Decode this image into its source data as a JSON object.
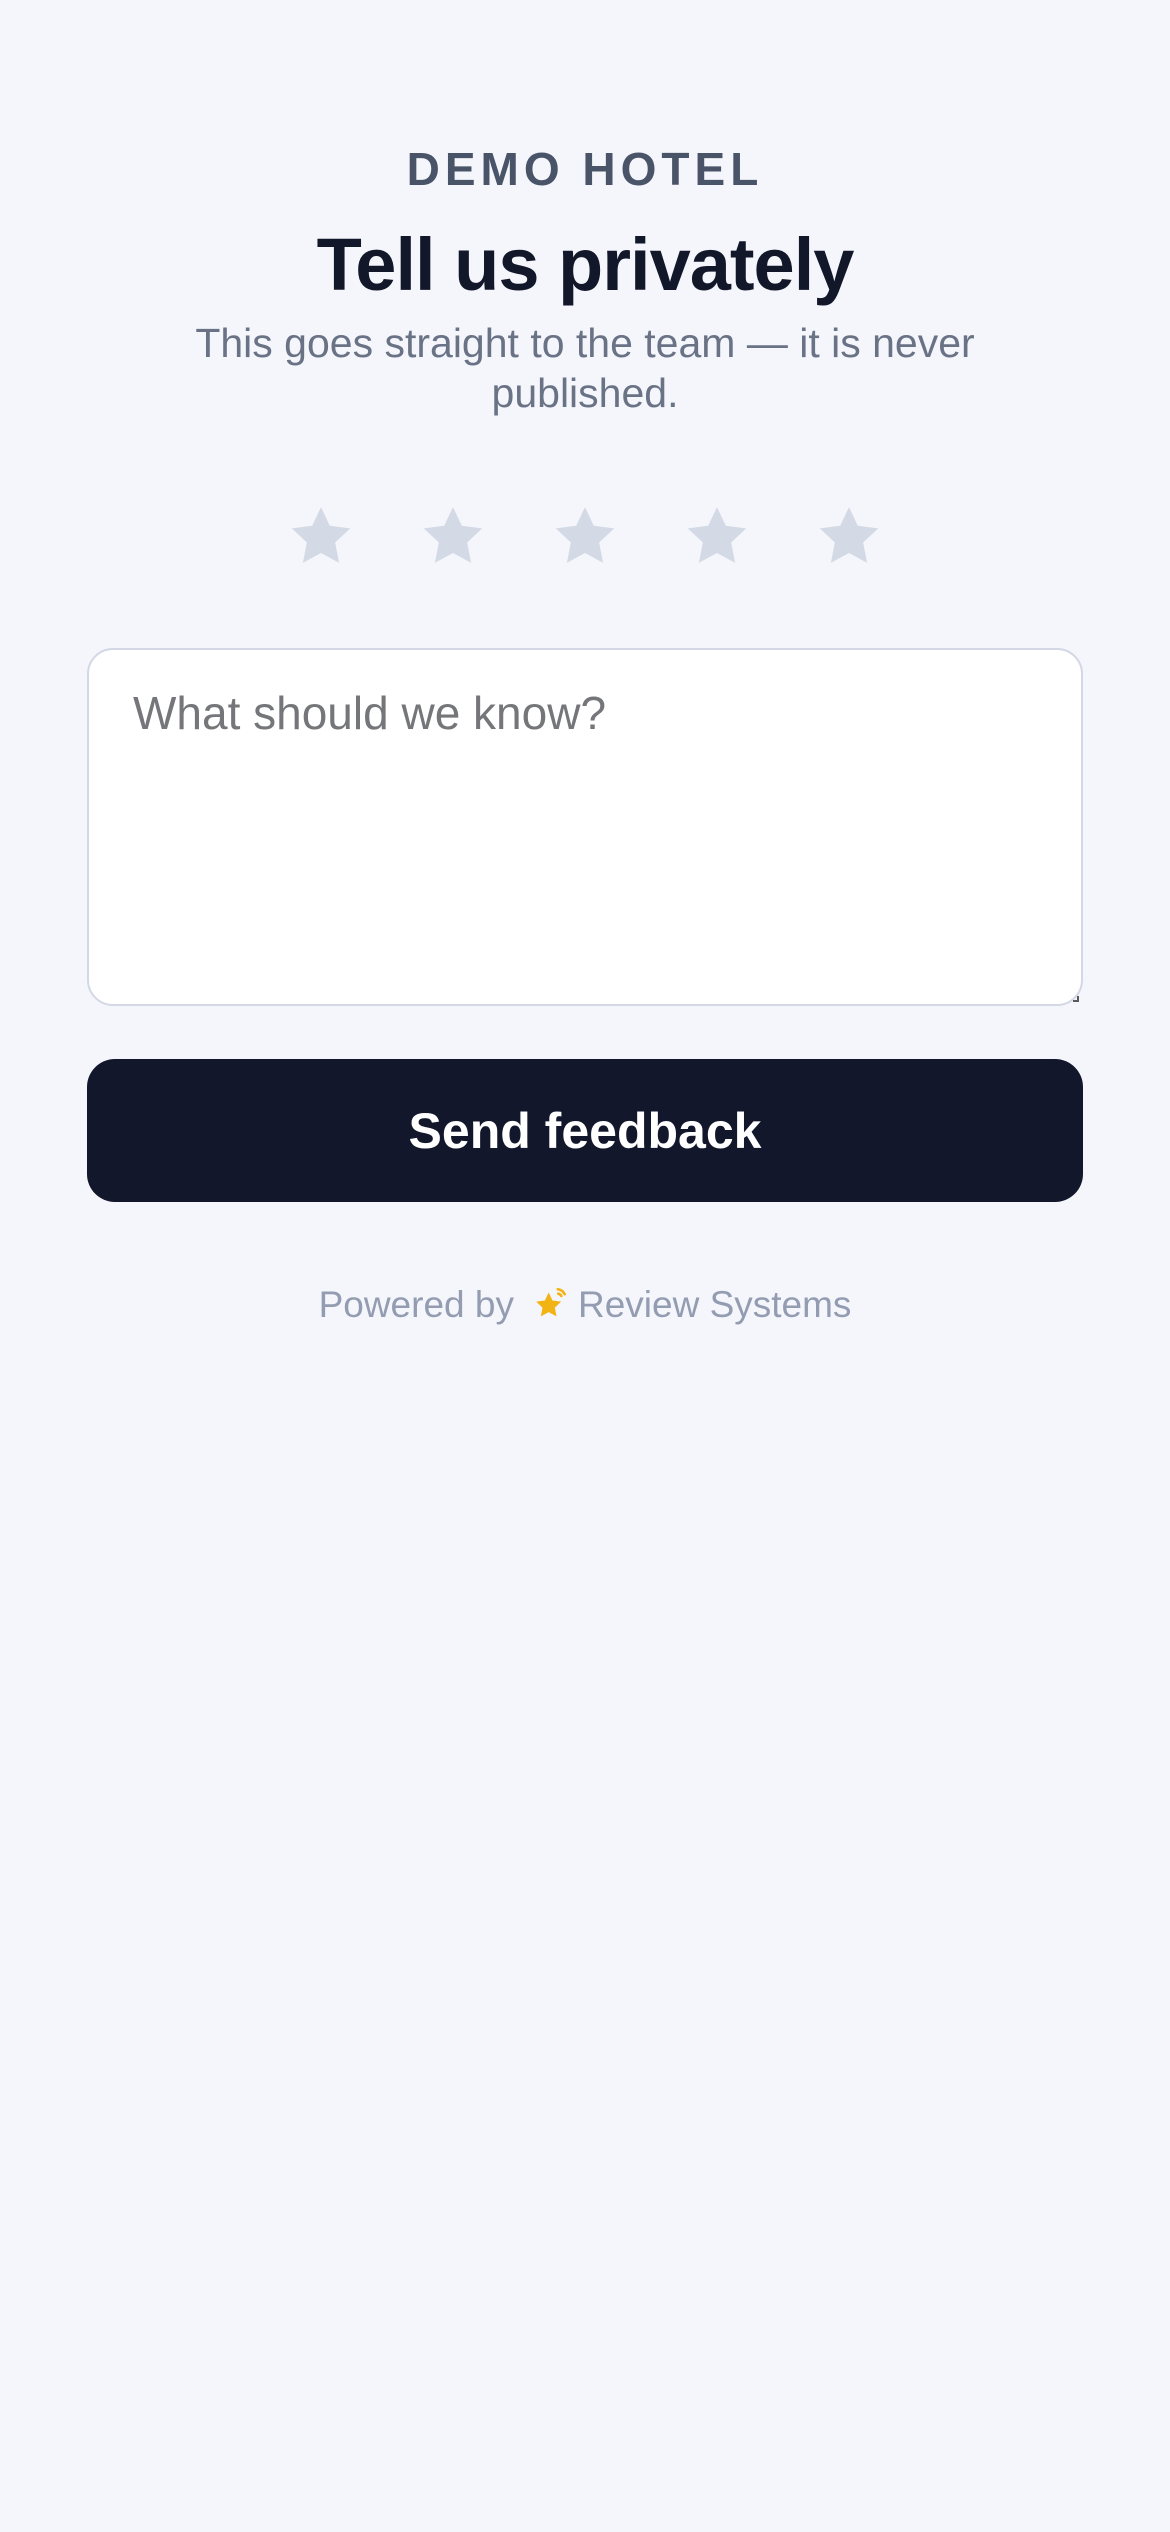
{
  "header": {
    "hotel_name": "DEMO HOTEL",
    "title": "Tell us privately",
    "subtitle": "This goes straight to the team — it is never published."
  },
  "rating": {
    "max_stars": 5,
    "selected": 0,
    "star_icon": "star-icon",
    "empty_color": "#d3d9e5"
  },
  "feedback": {
    "value": "",
    "placeholder": "What should we know?"
  },
  "submit": {
    "label": "Send feedback",
    "background": "#12172b"
  },
  "footer": {
    "powered_prefix": "Powered by",
    "brand_name": "Review Systems",
    "brand_icon": "review-systems-logo-icon",
    "brand_icon_color": "#f2b415"
  }
}
